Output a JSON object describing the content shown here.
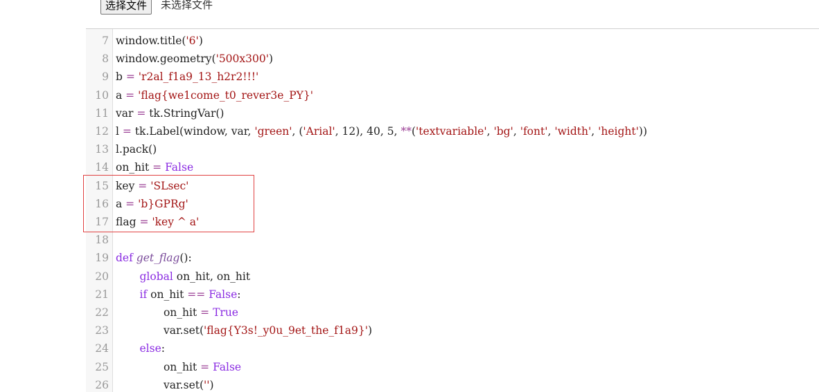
{
  "file_picker": {
    "button_label": "选择文件",
    "status_text": "未选择文件"
  },
  "colors": {
    "string": "#a31515",
    "keyword": "#8a2be2",
    "function_name": "#7a4b9a",
    "highlight_box": "#e04040"
  },
  "editor": {
    "lines": [
      {
        "num": "7",
        "tokens": [
          {
            "t": "window.title(",
            "c": "var"
          },
          {
            "t": "'6'",
            "c": "str"
          },
          {
            "t": ")",
            "c": "var"
          }
        ]
      },
      {
        "num": "8",
        "tokens": [
          {
            "t": "window.geometry(",
            "c": "var"
          },
          {
            "t": "'500x300'",
            "c": "str"
          },
          {
            "t": ")",
            "c": "var"
          }
        ]
      },
      {
        "num": "9",
        "tokens": [
          {
            "t": "b ",
            "c": "var"
          },
          {
            "t": "=",
            "c": "op"
          },
          {
            "t": " ",
            "c": "var"
          },
          {
            "t": "'r2al_f1a9_13_h2r2!!!'",
            "c": "str"
          }
        ]
      },
      {
        "num": "10",
        "tokens": [
          {
            "t": "a ",
            "c": "var"
          },
          {
            "t": "=",
            "c": "op"
          },
          {
            "t": " ",
            "c": "var"
          },
          {
            "t": "'flag{we1come_t0_rever3e_PY}'",
            "c": "str"
          }
        ]
      },
      {
        "num": "11",
        "tokens": [
          {
            "t": "var ",
            "c": "var"
          },
          {
            "t": "=",
            "c": "op"
          },
          {
            "t": " tk.StringVar()",
            "c": "var"
          }
        ]
      },
      {
        "num": "12",
        "tokens": [
          {
            "t": "l ",
            "c": "var"
          },
          {
            "t": "=",
            "c": "op"
          },
          {
            "t": " tk.Label(window, var, ",
            "c": "var"
          },
          {
            "t": "'green'",
            "c": "str"
          },
          {
            "t": ", (",
            "c": "var"
          },
          {
            "t": "'Arial'",
            "c": "str"
          },
          {
            "t": ", 12), 40, 5, ",
            "c": "var"
          },
          {
            "t": "**",
            "c": "op"
          },
          {
            "t": "(",
            "c": "var"
          },
          {
            "t": "'textvariable'",
            "c": "str"
          },
          {
            "t": ", ",
            "c": "var"
          },
          {
            "t": "'bg'",
            "c": "str"
          },
          {
            "t": ", ",
            "c": "var"
          },
          {
            "t": "'font'",
            "c": "str"
          },
          {
            "t": ", ",
            "c": "var"
          },
          {
            "t": "'width'",
            "c": "str"
          },
          {
            "t": ", ",
            "c": "var"
          },
          {
            "t": "'height'",
            "c": "str"
          },
          {
            "t": "))",
            "c": "var"
          }
        ]
      },
      {
        "num": "13",
        "tokens": [
          {
            "t": "l.pack()",
            "c": "var"
          }
        ]
      },
      {
        "num": "14",
        "tokens": [
          {
            "t": "on_hit ",
            "c": "var"
          },
          {
            "t": "=",
            "c": "op"
          },
          {
            "t": " ",
            "c": "var"
          },
          {
            "t": "False",
            "c": "kw"
          }
        ]
      },
      {
        "num": "15",
        "tokens": [
          {
            "t": "key ",
            "c": "var"
          },
          {
            "t": "=",
            "c": "op"
          },
          {
            "t": " ",
            "c": "var"
          },
          {
            "t": "'SLsec'",
            "c": "str"
          }
        ]
      },
      {
        "num": "16",
        "tokens": [
          {
            "t": "a ",
            "c": "var"
          },
          {
            "t": "=",
            "c": "op"
          },
          {
            "t": " ",
            "c": "var"
          },
          {
            "t": "'b}GPRg'",
            "c": "str"
          }
        ]
      },
      {
        "num": "17",
        "tokens": [
          {
            "t": "flag ",
            "c": "var"
          },
          {
            "t": "=",
            "c": "op"
          },
          {
            "t": " ",
            "c": "var"
          },
          {
            "t": "'key ^ a'",
            "c": "str"
          }
        ]
      },
      {
        "num": "18",
        "tokens": []
      },
      {
        "num": "19",
        "tokens": [
          {
            "t": "def",
            "c": "kw"
          },
          {
            "t": " ",
            "c": "var"
          },
          {
            "t": "get_flag",
            "c": "fn"
          },
          {
            "t": "():",
            "c": "var"
          }
        ]
      },
      {
        "num": "20",
        "tokens": [
          {
            "t": "       ",
            "c": "var"
          },
          {
            "t": "global",
            "c": "kw"
          },
          {
            "t": " on_hit, on_hit",
            "c": "var"
          }
        ]
      },
      {
        "num": "21",
        "tokens": [
          {
            "t": "       ",
            "c": "var"
          },
          {
            "t": "if",
            "c": "kw"
          },
          {
            "t": " on_hit ",
            "c": "var"
          },
          {
            "t": "==",
            "c": "op"
          },
          {
            "t": " ",
            "c": "var"
          },
          {
            "t": "False",
            "c": "kw"
          },
          {
            "t": ":",
            "c": "var"
          }
        ]
      },
      {
        "num": "22",
        "tokens": [
          {
            "t": "              on_hit ",
            "c": "var"
          },
          {
            "t": "=",
            "c": "op"
          },
          {
            "t": " ",
            "c": "var"
          },
          {
            "t": "True",
            "c": "kw"
          }
        ]
      },
      {
        "num": "23",
        "tokens": [
          {
            "t": "              var.set(",
            "c": "var"
          },
          {
            "t": "'flag{Y3s!_y0u_9et_the_f1a9}'",
            "c": "str"
          },
          {
            "t": ")",
            "c": "var"
          }
        ]
      },
      {
        "num": "24",
        "tokens": [
          {
            "t": "       ",
            "c": "var"
          },
          {
            "t": "else",
            "c": "kw"
          },
          {
            "t": ":",
            "c": "var"
          }
        ]
      },
      {
        "num": "25",
        "tokens": [
          {
            "t": "              on_hit ",
            "c": "var"
          },
          {
            "t": "=",
            "c": "op"
          },
          {
            "t": " ",
            "c": "var"
          },
          {
            "t": "False",
            "c": "kw"
          }
        ]
      },
      {
        "num": "26",
        "tokens": [
          {
            "t": "              var.set(",
            "c": "var"
          },
          {
            "t": "''",
            "c": "str"
          },
          {
            "t": ")",
            "c": "var"
          }
        ]
      }
    ]
  }
}
